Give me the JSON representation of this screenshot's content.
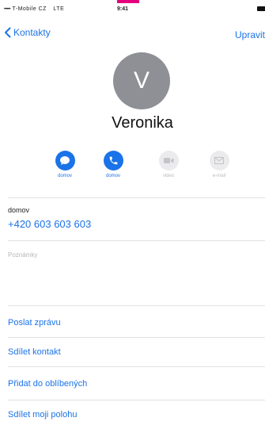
{
  "status_bar": {
    "signal_dots": "•••••",
    "carrier": "T-Mobile CZ",
    "network": "LTE",
    "time": "9:41"
  },
  "nav": {
    "back_label": "Kontakty",
    "edit_label": "Upravit"
  },
  "contact": {
    "initial": "V",
    "name": "Veronika"
  },
  "actions": [
    {
      "label": "domov",
      "icon": "message-icon",
      "enabled": true
    },
    {
      "label": "domov",
      "icon": "phone-icon",
      "enabled": true
    },
    {
      "label": "video",
      "icon": "video-icon",
      "enabled": false
    },
    {
      "label": "e-mail",
      "icon": "mail-icon",
      "enabled": false
    }
  ],
  "phone_field": {
    "label": "domov",
    "number": "+420 603 603 603"
  },
  "notes": {
    "placeholder": "Poznámky"
  },
  "links": {
    "send_message": "Poslat zprávu",
    "share_contact": "Sdílet kontakt",
    "add_favorites": "Přidat do oblíbených",
    "share_location": "Sdílet moji polohu"
  },
  "colors": {
    "accent": "#1a73e8",
    "avatar": "#8e9096",
    "brand_tab": "#e5007e"
  }
}
